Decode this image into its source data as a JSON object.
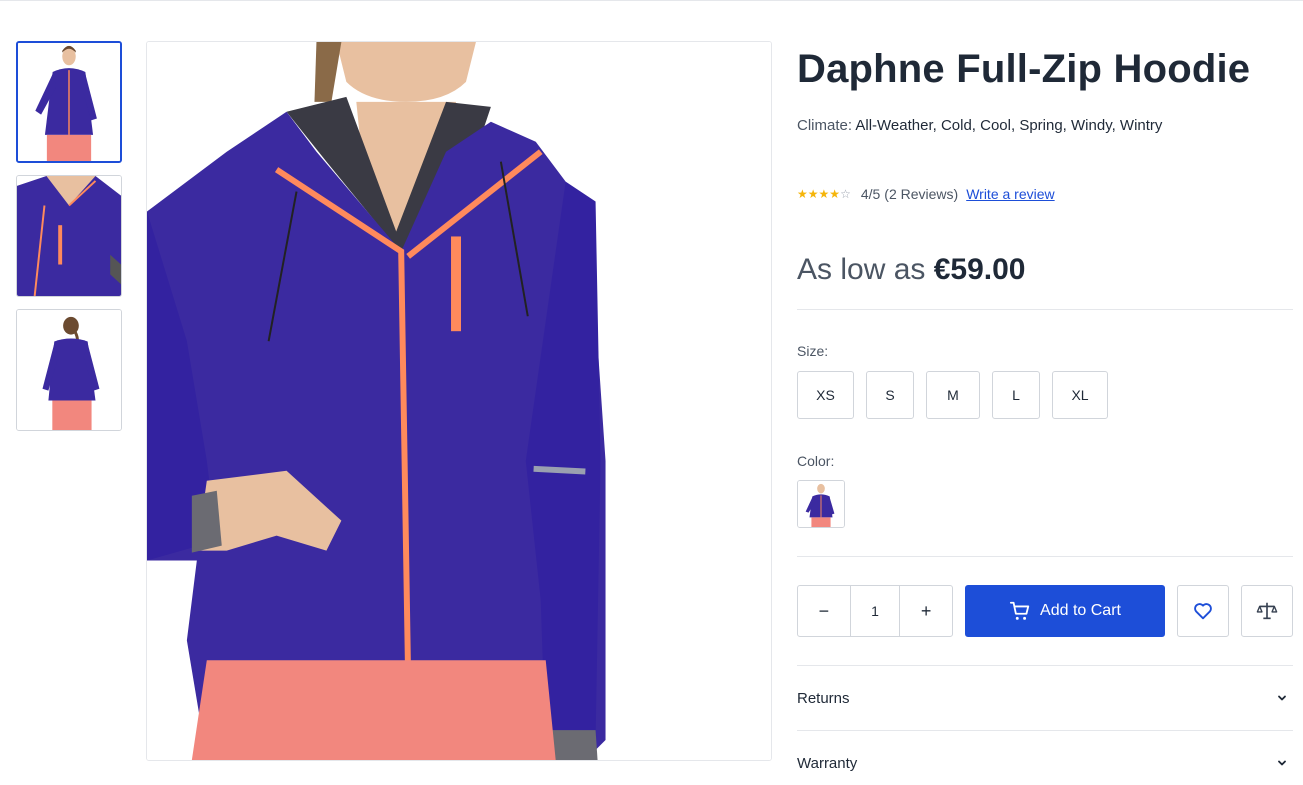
{
  "product": {
    "title": "Daphne Full-Zip Hoodie",
    "climate_label": "Climate:",
    "climate_values": "All-Weather, Cold, Cool, Spring, Windy, Wintry",
    "rating": {
      "stars_filled": 4,
      "stars_total": 5,
      "score": "4/5",
      "reviews": "(2 Reviews)",
      "write_review": "Write a review"
    },
    "price_prefix": "As low as",
    "price": "€59.00"
  },
  "gallery": {
    "thumbnails": [
      {
        "alt": "front view",
        "active": true
      },
      {
        "alt": "detail view",
        "active": false
      },
      {
        "alt": "back view",
        "active": false
      }
    ]
  },
  "options": {
    "size_label": "Size:",
    "sizes": [
      "XS",
      "S",
      "M",
      "L",
      "XL"
    ],
    "color_label": "Color:"
  },
  "cart": {
    "minus": "−",
    "quantity": "1",
    "plus": "+",
    "add_to_cart": "Add to Cart"
  },
  "accordions": [
    "Returns",
    "Warranty"
  ],
  "colors": {
    "accent": "#1d4ed8",
    "hoodie": "#3b2aa0",
    "zip": "#ff8a5c",
    "star": "#f5b50a"
  },
  "icons": {
    "cart": "cart-icon",
    "wishlist": "heart-icon",
    "compare": "scale-icon",
    "expand": "chevron-down-icon"
  }
}
